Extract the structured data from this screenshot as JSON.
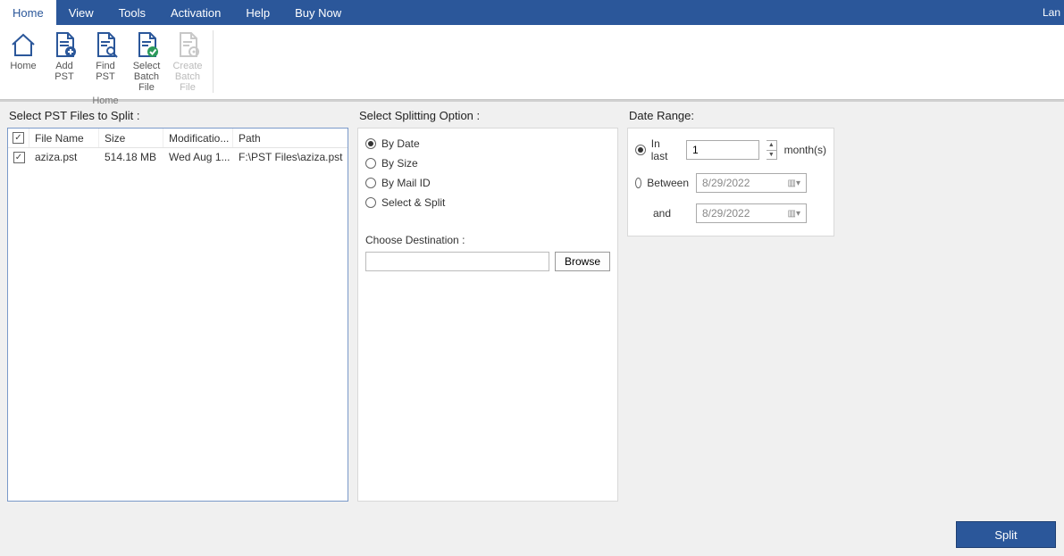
{
  "menubar": {
    "tabs": [
      "Home",
      "View",
      "Tools",
      "Activation",
      "Help",
      "Buy Now"
    ],
    "active": 0,
    "right": "Lan"
  },
  "ribbon": {
    "group_label": "Home",
    "items": [
      {
        "label_l1": "Home",
        "label_l2": ""
      },
      {
        "label_l1": "Add",
        "label_l2": "PST"
      },
      {
        "label_l1": "Find",
        "label_l2": "PST"
      },
      {
        "label_l1": "Select",
        "label_l2": "Batch File"
      },
      {
        "label_l1": "Create",
        "label_l2": "Batch File"
      }
    ]
  },
  "left": {
    "title": "Select PST Files to Split :",
    "headers": {
      "name": "File Name",
      "size": "Size",
      "mod": "Modificatio...",
      "path": "Path"
    },
    "rows": [
      {
        "checked": true,
        "name": "aziza.pst",
        "size": "514.18 MB",
        "mod": "Wed Aug 1...",
        "path": "F:\\PST Files\\aziza.pst"
      }
    ]
  },
  "mid": {
    "title": "Select Splitting Option :",
    "options": [
      {
        "label": "By Date",
        "selected": true
      },
      {
        "label": "By Size",
        "selected": false
      },
      {
        "label": "By Mail ID",
        "selected": false
      },
      {
        "label": "Select & Split",
        "selected": false
      }
    ],
    "dest_label": "Choose Destination :",
    "dest_value": "",
    "browse": "Browse"
  },
  "right": {
    "title": "Date Range:",
    "inlast": {
      "label": "In last",
      "value": "1",
      "unit": "month(s)",
      "selected": true
    },
    "between": {
      "label": "Between",
      "from": "8/29/2022",
      "to": "8/29/2022",
      "and": "and",
      "selected": false
    }
  },
  "split_button": "Split"
}
